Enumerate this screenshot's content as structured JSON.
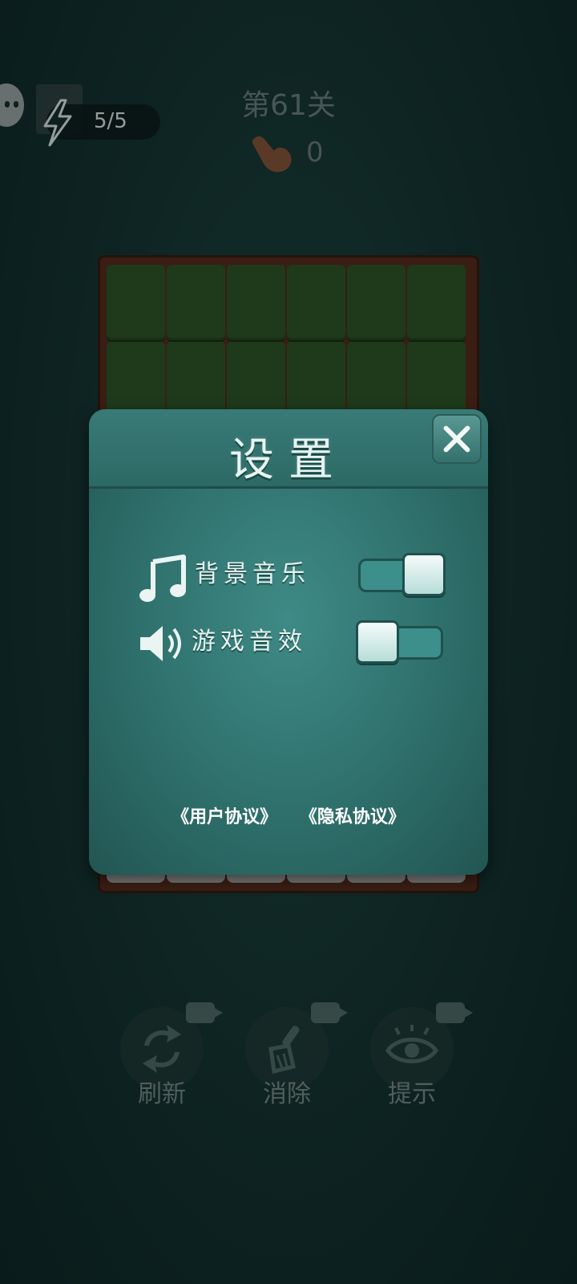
{
  "hud": {
    "energy": "5/5",
    "level_title": "第61关",
    "moves": "0"
  },
  "tools": [
    {
      "label": "刷新",
      "icon": "refresh-icon"
    },
    {
      "label": "消除",
      "icon": "broom-icon"
    },
    {
      "label": "提示",
      "icon": "eye-icon"
    }
  ],
  "settings": {
    "title": "设置",
    "rows": [
      {
        "label": "背景音乐",
        "icon": "music-note-icon",
        "enabled": true
      },
      {
        "label": "游戏音效",
        "icon": "speaker-icon",
        "enabled": false
      }
    ],
    "links": {
      "user_agreement": "《用户协议》",
      "privacy_policy": "《隐私协议》"
    }
  },
  "colors": {
    "background": "#173a37",
    "tile": "#2f5a2a",
    "board": "#5a2e1f",
    "modal": "#2e6f6b"
  }
}
